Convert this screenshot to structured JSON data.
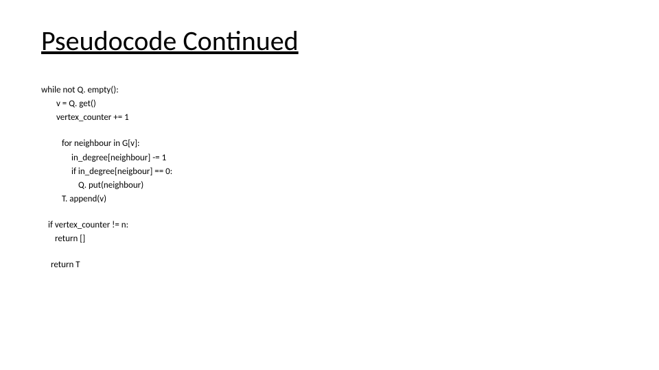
{
  "title": "Pseudocode Continued",
  "code": {
    "l1": "while not Q. empty():",
    "l2": "v = Q. get()",
    "l3": "vertex_counter += 1",
    "l4": "for neighbour in G[v]:",
    "l5": "in_degree[neighbour] -= 1",
    "l6": "if in_degree[neigbour] == 0:",
    "l7": "Q. put(neighbour)",
    "l8": "T. append(v)",
    "l9": "if vertex_counter != n:",
    "l10": "return []",
    "l11": "return T"
  }
}
